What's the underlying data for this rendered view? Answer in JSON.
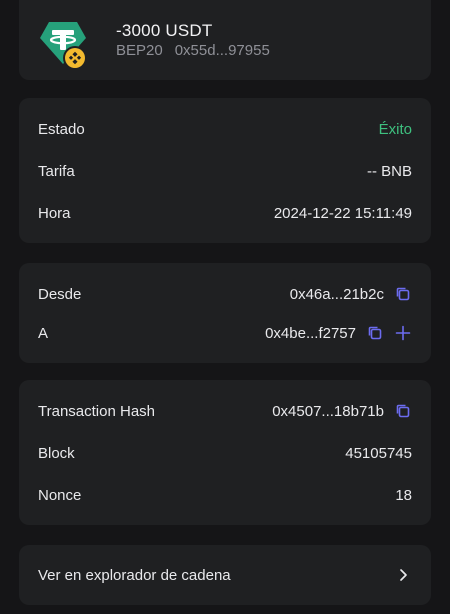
{
  "token": {
    "amount": "-3000 USDT",
    "network": "BEP20",
    "address": "0x55d...97955",
    "icon": "tether-logo-icon",
    "badge_icon": "bnb-badge-icon"
  },
  "status_card": {
    "estado_label": "Estado",
    "estado_value": "Éxito",
    "tarifa_label": "Tarifa",
    "tarifa_value": "-- BNB",
    "hora_label": "Hora",
    "hora_value": "2024-12-22 15:11:49"
  },
  "address_card": {
    "desde_label": "Desde",
    "desde_value": "0x46a...21b2c",
    "a_label": "A",
    "a_value": "0x4be...f2757"
  },
  "tx_card": {
    "hash_label": "Transaction Hash",
    "hash_value": "0x4507...18b71b",
    "block_label": "Block",
    "block_value": "45105745",
    "nonce_label": "Nonce",
    "nonce_value": "18"
  },
  "explorer": {
    "label": "Ver en explorador de cadena"
  },
  "colors": {
    "background": "#151517",
    "card": "#1f2022",
    "success": "#3ec07f",
    "accent_icon": "#6c6cf0",
    "tether": "#26a17b",
    "bnb": "#f3ba2f"
  }
}
